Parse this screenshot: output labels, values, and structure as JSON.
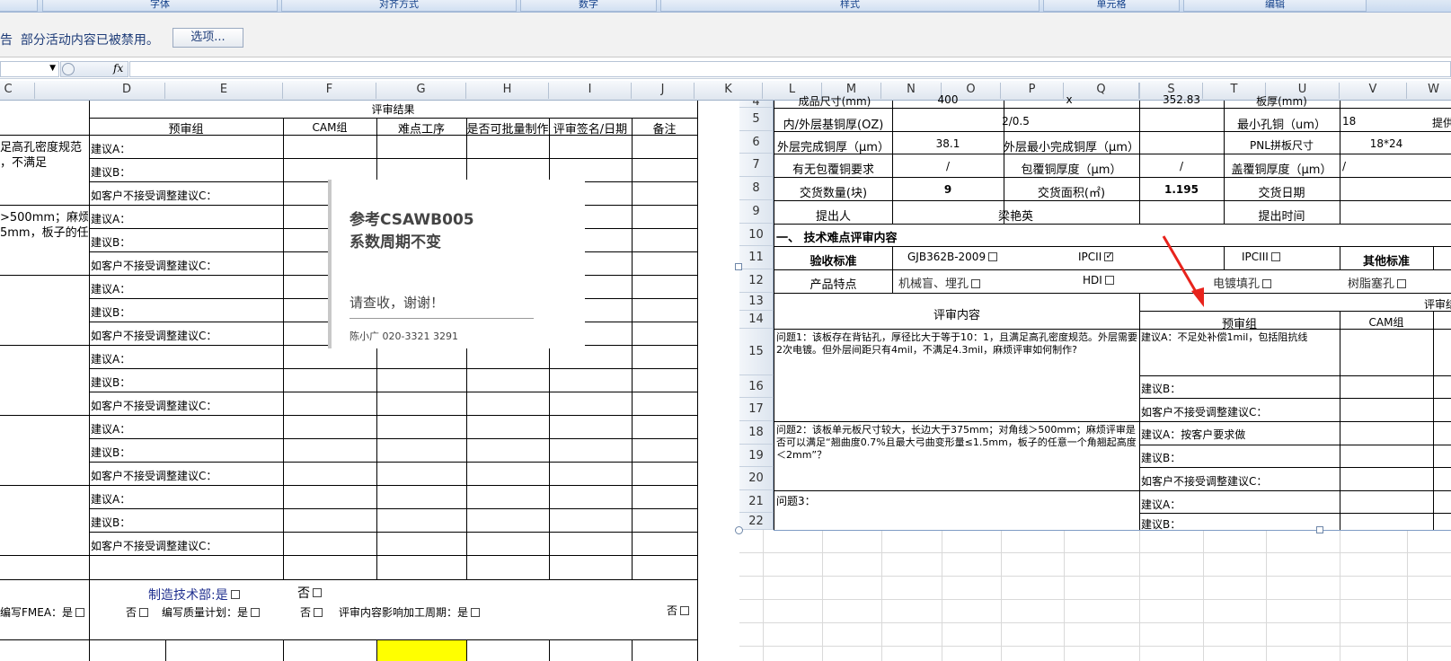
{
  "ribbon": {
    "groups": [
      "字体",
      "对齐方式",
      "数字",
      "样式",
      "单元格",
      "编辑"
    ]
  },
  "security_bar": {
    "prefix": "告",
    "message": "部分活动内容已被禁用。",
    "options_button": "选项..."
  },
  "formula_bar": {
    "fx_label": "fx"
  },
  "left_sheet": {
    "col_headers": [
      "C",
      "D",
      "E",
      "F",
      "G",
      "H",
      "I",
      "J",
      "K"
    ],
    "review_result_header": "评审结果",
    "sub_headers": [
      "预审组",
      "CAM组",
      "难点工序",
      "是否可批量制作",
      "评审签名/日期",
      "备注"
    ],
    "c_text1": "足高孔密度规范",
    "c_text1b": "，不满足",
    "c_text2": ">500mm；麻烦",
    "c_text2b": "5mm，板子的任",
    "suggestions": [
      "建议A：",
      "建议B：",
      "如客户不接受调整建议C："
    ],
    "footer": {
      "mfg_label": "制造技术部:是",
      "mfg_no": "否",
      "fmea": "编写FMEA：是",
      "fmea_no": "否",
      "quality_plan": "编写质量计划：是",
      "qp_no": "否",
      "review_effect": "评审内容影响加工周期：是",
      "re_no": "否"
    }
  },
  "note": {
    "line1": "参考CSAWB005",
    "line2": "系数周期不变",
    "line3": "请查收，谢谢！",
    "signature": "陈小广  020-3321  3291"
  },
  "right_sheet": {
    "col_headers": [
      "L",
      "M",
      "N",
      "O",
      "P",
      "Q",
      "R",
      "S",
      "T",
      "U",
      "V",
      "W"
    ],
    "row_nums": [
      "4",
      "5",
      "6",
      "7",
      "8",
      "9",
      "10",
      "11",
      "12",
      "13",
      "14",
      "15",
      "16",
      "17",
      "18",
      "19",
      "20",
      "21",
      "22"
    ],
    "row4": {
      "a": "成品尺寸(mm)",
      "b": "400",
      "c": "x",
      "d": "352.83",
      "e": "板厚(mm)"
    },
    "row5": {
      "label": "内/外层基铜厚(OZ)",
      "value": "2/0.5",
      "label2": "最小孔铜（um）",
      "value2": "18",
      "cut": "提供"
    },
    "row6": {
      "label": "外层完成铜厚（μm）",
      "value": "38.1",
      "label2": "外层最小完成铜厚（μm）",
      "label3": "PNL拼板尺寸",
      "value3": "18*24"
    },
    "row7": {
      "label": "有无包覆铜要求",
      "value": "/",
      "label2": "包覆铜厚度（μm）",
      "value2": "/",
      "label3": "盖覆铜厚度（μm）",
      "value3": "/"
    },
    "row8": {
      "label": "交货数量(块)",
      "value": "9",
      "label2": "交货面积(㎡)",
      "value2": "1.195",
      "label3": "交货日期"
    },
    "row9": {
      "label": "提出人",
      "value": "梁艳英",
      "label2": "提出时间"
    },
    "row10": {
      "title": "一、 技术难点评审内容"
    },
    "row11": {
      "label": "验收标准",
      "opt1": "GJB362B-2009",
      "opt2": "IPCII",
      "opt3": "IPCIII",
      "other": "其他标准"
    },
    "row12": {
      "label": "产品特点",
      "opt1": "机械盲、埋孔",
      "opt2": "HDI",
      "opt3": "电镀填孔",
      "opt4": "树脂塞孔"
    },
    "row13": {
      "review_content": "评审内容",
      "review_cut": "评审结"
    },
    "row14": {
      "pre": "预审组",
      "cam": "CAM组"
    },
    "q1": "问题1：该板存在背钻孔，厚径比大于等于10：1，且满足高孔密度规范。外层需要2次电镀。但外层间距只有4mil，不满足4.3mil，麻烦评审如何制作?",
    "q1a": "建议A：不足处补偿1mil，包括阻抗线",
    "q2": "问题2：该板单元板尺寸较大，长边大于375mm；对角线＞500mm；麻烦评审是否可以满足“翘曲度0.7%且最大弓曲变形量≤1.5mm，板子的任意一个角翘起高度＜2mm”？",
    "q2a": "建议A：按客户要求做",
    "q3": "问题3：",
    "sugB": "建议B：",
    "sugC": "如客户不接受调整建议C：",
    "sugA": "建议A："
  }
}
